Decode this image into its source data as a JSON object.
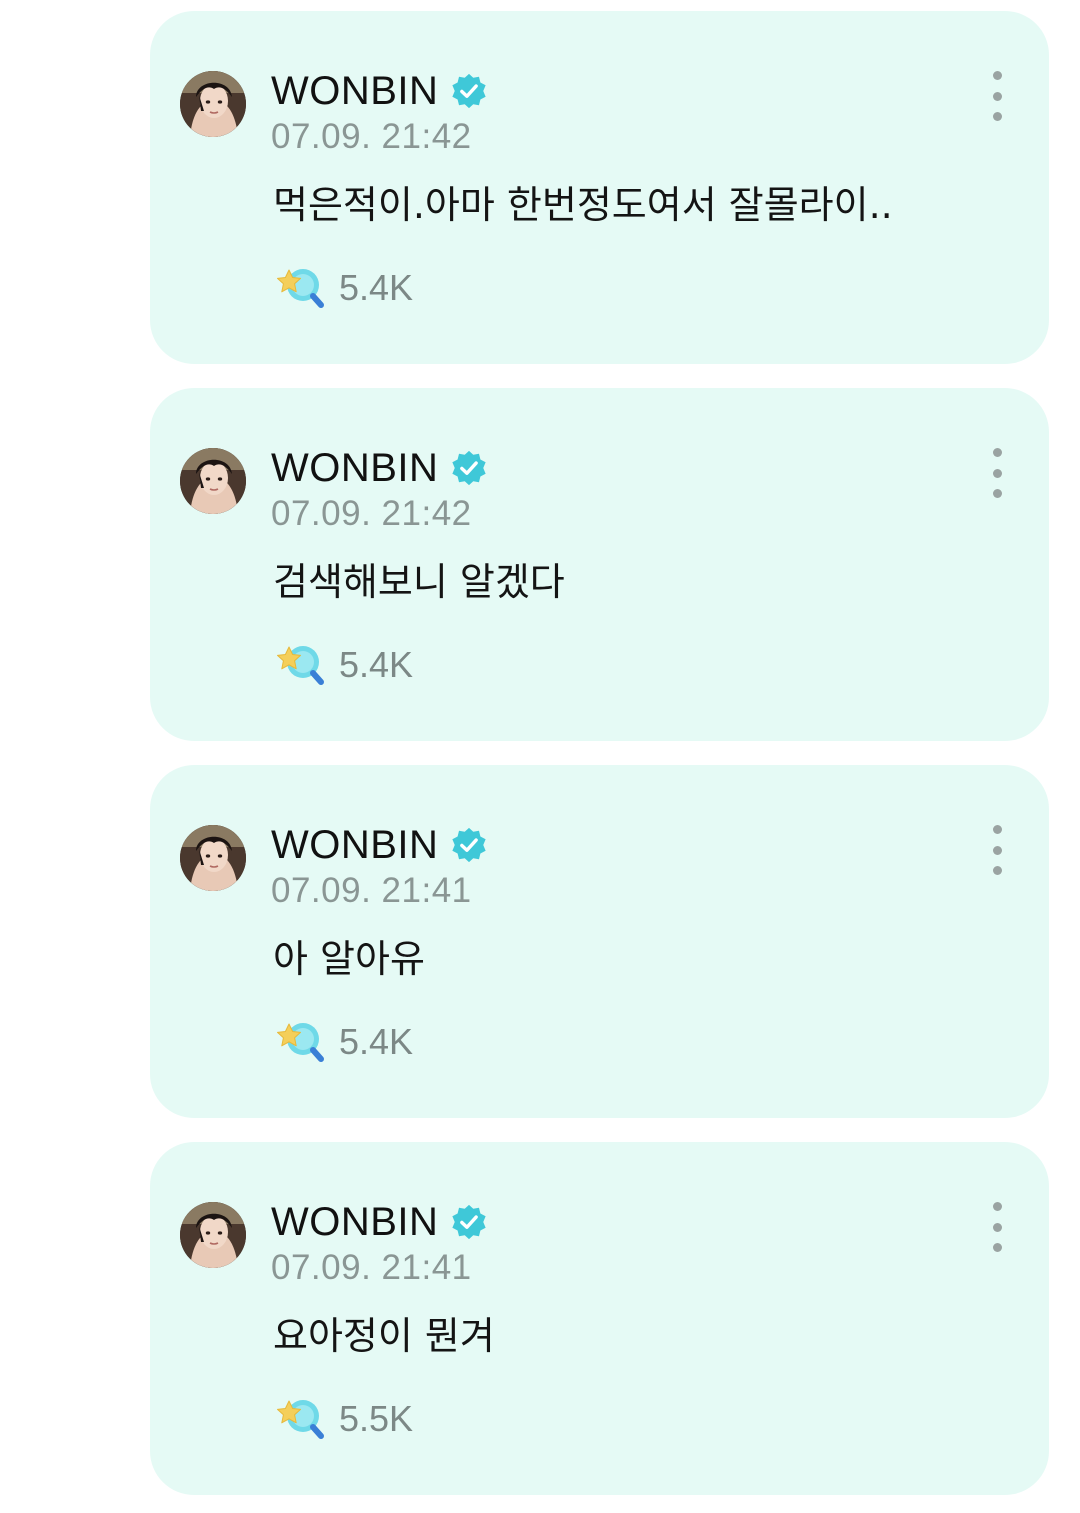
{
  "posts": [
    {
      "author": "WONBIN",
      "verified_icon": "verified-badge-icon",
      "timestamp": "07.09. 21:42",
      "message": "먹은적이.아마 한번정도여서 잘몰라이..",
      "reaction_icon": "star-magnifier-reaction-icon",
      "reaction_count": "5.4K"
    },
    {
      "author": "WONBIN",
      "verified_icon": "verified-badge-icon",
      "timestamp": "07.09. 21:42",
      "message": "검색해보니 알겠다",
      "reaction_icon": "star-magnifier-reaction-icon",
      "reaction_count": "5.4K"
    },
    {
      "author": "WONBIN",
      "verified_icon": "verified-badge-icon",
      "timestamp": "07.09. 21:41",
      "message": "아 알아유",
      "reaction_icon": "star-magnifier-reaction-icon",
      "reaction_count": "5.4K"
    },
    {
      "author": "WONBIN",
      "verified_icon": "verified-badge-icon",
      "timestamp": "07.09. 21:41",
      "message": "요아정이 뭔겨",
      "reaction_icon": "star-magnifier-reaction-icon",
      "reaction_count": "5.5K"
    }
  ],
  "colors": {
    "card_background": "#e5faf5",
    "verified_badge": "#3fc8d8",
    "timestamp_text": "#8a9694",
    "reaction_count_text": "#7c8886",
    "more_dots": "#9aa3a2"
  }
}
